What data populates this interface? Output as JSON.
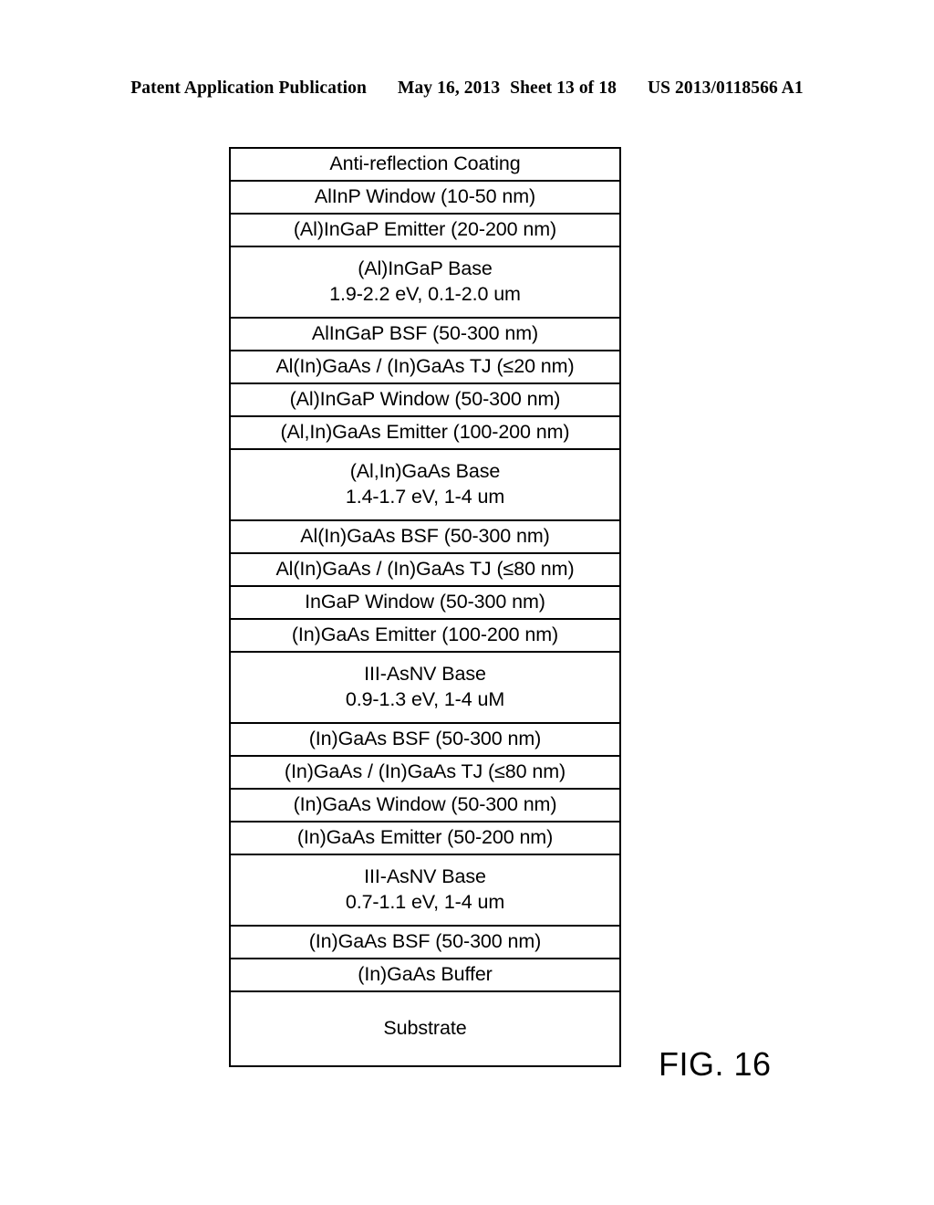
{
  "header": {
    "publication": "Patent Application Publication",
    "date": "May 16, 2013",
    "sheet": "Sheet 13 of 18",
    "number": "US 2013/0118566 A1"
  },
  "figure": {
    "label": "FIG. 16"
  },
  "diagram": {
    "type": "layer-stack",
    "description": "Multi-junction solar cell epitaxial layer stack",
    "layers": [
      {
        "type": "single",
        "line1": "Anti-reflection Coating",
        "line2": ""
      },
      {
        "type": "single",
        "line1": "AlInP Window (10-50 nm)",
        "line2": ""
      },
      {
        "type": "single",
        "line1": "(Al)InGaP Emitter (20-200 nm)",
        "line2": ""
      },
      {
        "type": "double",
        "line1": "(Al)InGaP Base",
        "line2": "1.9-2.2 eV, 0.1-2.0 um"
      },
      {
        "type": "single",
        "line1": "AlInGaP BSF (50-300 nm)",
        "line2": ""
      },
      {
        "type": "single",
        "line1": "Al(In)GaAs / (In)GaAs TJ (≤20 nm)",
        "line2": ""
      },
      {
        "type": "single",
        "line1": "(Al)InGaP Window (50-300 nm)",
        "line2": ""
      },
      {
        "type": "single",
        "line1": "(Al,In)GaAs Emitter (100-200 nm)",
        "line2": ""
      },
      {
        "type": "double",
        "line1": "(Al,In)GaAs Base",
        "line2": "1.4-1.7 eV, 1-4 um"
      },
      {
        "type": "single",
        "line1": "Al(In)GaAs BSF (50-300 nm)",
        "line2": ""
      },
      {
        "type": "single",
        "line1": "Al(In)GaAs / (In)GaAs TJ (≤80 nm)",
        "line2": ""
      },
      {
        "type": "single",
        "line1": "InGaP Window (50-300 nm)",
        "line2": ""
      },
      {
        "type": "single",
        "line1": "(In)GaAs Emitter (100-200 nm)",
        "line2": ""
      },
      {
        "type": "double",
        "line1": "III-AsNV Base",
        "line2": "0.9-1.3 eV, 1-4 uM"
      },
      {
        "type": "single",
        "line1": "(In)GaAs BSF (50-300 nm)",
        "line2": ""
      },
      {
        "type": "single",
        "line1": "(In)GaAs / (In)GaAs TJ (≤80 nm)",
        "line2": ""
      },
      {
        "type": "single",
        "line1": "(In)GaAs Window (50-300 nm)",
        "line2": ""
      },
      {
        "type": "single",
        "line1": "(In)GaAs Emitter (50-200 nm)",
        "line2": ""
      },
      {
        "type": "double",
        "line1": "III-AsNV Base",
        "line2": "0.7-1.1 eV, 1-4 um"
      },
      {
        "type": "single",
        "line1": "(In)GaAs BSF (50-300 nm)",
        "line2": ""
      },
      {
        "type": "single",
        "line1": "(In)GaAs Buffer",
        "line2": ""
      },
      {
        "type": "substrate",
        "line1": "Substrate",
        "line2": ""
      }
    ]
  },
  "colors": {
    "ink": "#000000",
    "page": "#ffffff"
  }
}
